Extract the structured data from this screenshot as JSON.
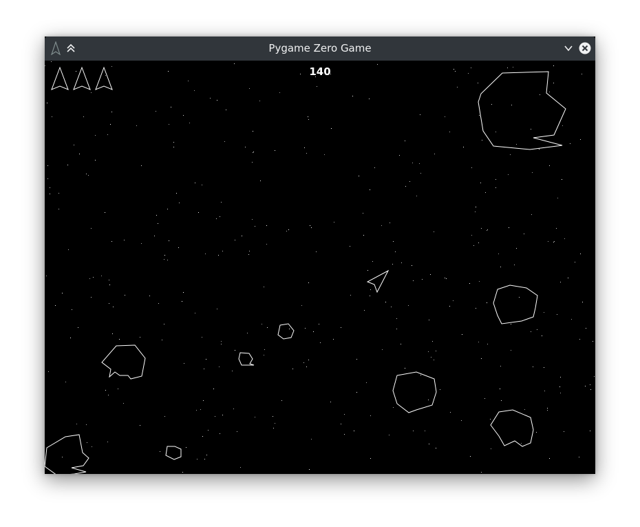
{
  "window": {
    "title": "Pygame Zero Game",
    "titlebar_color": "#31363b",
    "icons": {
      "app": "ship-icon",
      "keep_above": "double-chevron-up-icon",
      "minimize": "chevron-down-icon",
      "close": "close-circle-icon"
    }
  },
  "game": {
    "score": "140",
    "lives": 3,
    "background_color": "#000000",
    "line_color": "#ffffff"
  }
}
